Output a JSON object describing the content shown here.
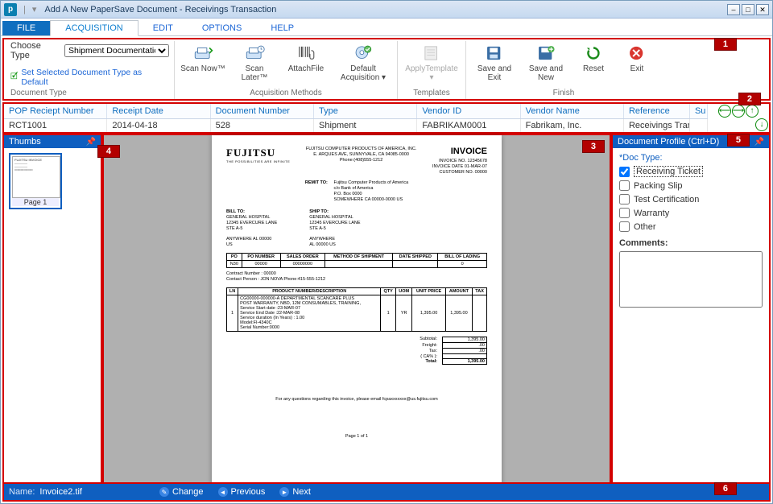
{
  "window": {
    "title": "Add A New PaperSave Document - Receivings Transaction",
    "app_icon_letter": "p"
  },
  "menu": {
    "file": "FILE",
    "acquisition": "ACQUISITION",
    "edit": "EDIT",
    "options": "OPTIONS",
    "help": "HELP"
  },
  "ribbon": {
    "choose_type_label": "Choose Type",
    "choose_type_value": "Shipment Documentatio",
    "set_default": "Set Selected Document Type as Default",
    "group_doc": "Document Type",
    "group_acq": "Acquisition Methods",
    "group_tpl": "Templates",
    "group_fin": "Finish",
    "scan_now": "Scan Now™",
    "scan_later": "Scan Later™",
    "attach": "AttachFile",
    "default_acq": "Default Acquisition",
    "apply_tpl": "ApplyTemplate",
    "save_exit": "Save and Exit",
    "save_new": "Save and New",
    "reset": "Reset",
    "exit": "Exit"
  },
  "grid": {
    "headers": [
      "POP Reciept Number",
      "Receipt Date",
      "Document Number",
      "Type",
      "Vendor ID",
      "Vendor Name",
      "Reference",
      "Su"
    ],
    "row": [
      "RCT1001",
      "2014-04-18",
      "528",
      "Shipment",
      "FABRIKAM0001",
      "Fabrikam, Inc.",
      "Receivings Transa",
      ""
    ]
  },
  "thumbs": {
    "title": "Thumbs",
    "page_label": "Page 1"
  },
  "profile": {
    "title": "Document Profile (Ctrl+D)",
    "doc_type_label": "*Doc Type:",
    "options": [
      "Receiving Ticket",
      "Packing Slip",
      "Test Certification",
      "Warranty",
      "Other"
    ],
    "checked_index": 0,
    "comments_label": "Comments:"
  },
  "bottom": {
    "name_label": "Name:",
    "name_value": "Invoice2.tif",
    "change": "Change",
    "previous": "Previous",
    "next": "Next"
  },
  "callouts": {
    "1": "1",
    "2": "2",
    "3": "3",
    "4": "4",
    "5": "5",
    "6": "6"
  },
  "invoice": {
    "logo": "FUJITSU",
    "logo_sub": "THE POSSIBILITIES ARE INFINITE",
    "title": "INVOICE",
    "company_addr": "FUJITSU COMPUTER PRODUCTS OF AMERICA, INC.\nE. ARQUES AVE, SUNNYVALE, CA 94085-0000\nPhone:(408)555-1212",
    "remit_label": "REMIT TO:",
    "remit": "Fujitsu Computer Products of America\nc/o Bank of America\nP.O. Box 0000\nSOMEWHERE CA 00000-0000 US",
    "meta": "INVOICE NO. 12345678\nINVOICE DATE 01-MAR-07\nCUSTOMER NO. 00000",
    "billto_label": "BILL TO:",
    "billto": "GENERAL HOSPITAL\n12345 EVERCURE LANE\nSTE A-5",
    "shipto_label": "SHIP TO:",
    "shipto": "GENERAL HOSPITAL\n12345 EVERCURE LANE\nSTE A-5",
    "billloc": "ANYWHERE AL 00000\nUS",
    "shiploc": "ANYWHERE\nAL 00000 US",
    "hdr": [
      "PO",
      "PO NUMBER",
      "SALES ORDER",
      "METHOD OF SHIPMENT",
      "DATE SHIPPED",
      "BILL OF LADING"
    ],
    "hdrvals": [
      "N30",
      "00000",
      "00000000",
      "",
      "",
      "0"
    ],
    "contract": "Contract Number : 00000\nContact Person   : JON NOVA   Phone:415-555-1212",
    "line_hdr": [
      "LN",
      "PRODUCT NUMBER/DESCRIPTION",
      "QTY",
      "UOM",
      "UNIT PRICE",
      "AMOUNT",
      "TAX"
    ],
    "line": [
      "1",
      "CG00000-000000-A DEPARTMENTAL SCANCARE PLUS\nPOST WARRANTY, NBD, 12M CONSUMABLES, TRAINING,\nService Start date :23-MAR-07\nService End Date :22-MAR-08\nService duration (In Years) : 1.00\nModel:FI-4340C\nSerial Number:0000",
      "1",
      "YR",
      "1,395.00",
      "1,395.00",
      ""
    ],
    "totals": [
      [
        "Subtotal:",
        "1,395.00"
      ],
      [
        "Freight:",
        ".00"
      ],
      [
        "Tax:",
        ".00"
      ],
      [
        "( CA% ):",
        ""
      ],
      [
        "Total:",
        "1,395.00"
      ]
    ],
    "foot": "For any questions regarding this invoice, please email fcpaxxxxxxx@us.fujitsu.com",
    "pager": "Page    1    of    1"
  }
}
